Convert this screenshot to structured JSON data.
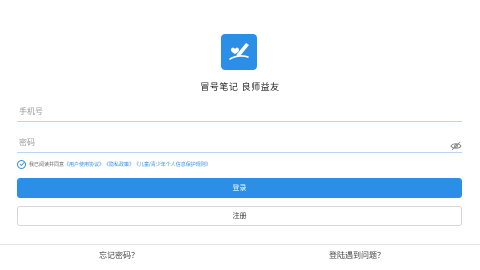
{
  "app": {
    "title": "冒号笔记  良师益友"
  },
  "login_form": {
    "phone_placeholder": "手机号",
    "password_placeholder": "密码"
  },
  "agreement": {
    "prefix": "我已阅读并同意",
    "user_agreement": "《用户使用协议》",
    "privacy_policy": "《隐私政策》",
    "child_protection": "《儿童/青少年个人信息保护规则》"
  },
  "buttons": {
    "login": "登录",
    "register": "注册"
  },
  "footer": {
    "forgot_password": "忘记密码？",
    "login_problem": "登陆遇到问题？"
  },
  "colors": {
    "accent": "#2b8fe8"
  },
  "icons": [
    "app-logo-icon",
    "eye-icon",
    "checkbox-check-icon"
  ]
}
